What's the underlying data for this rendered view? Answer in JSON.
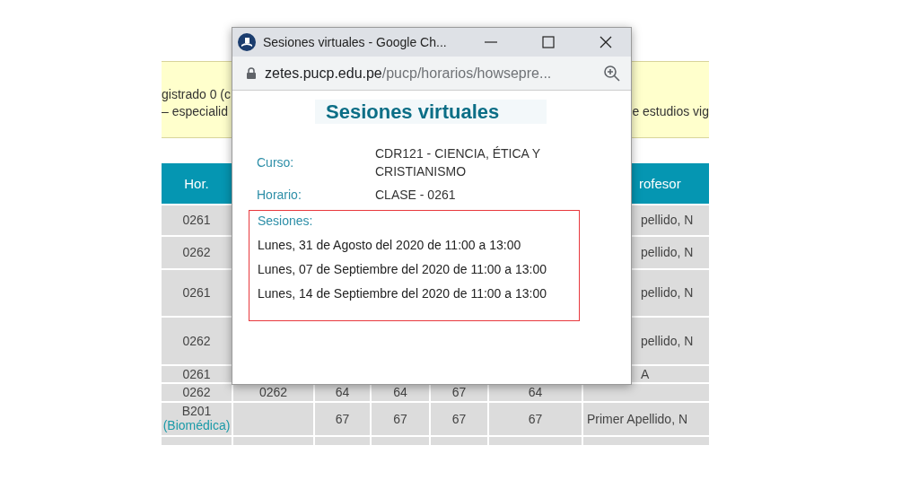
{
  "notice": {
    "left_lines": [
      "gistrado 0 (c",
      "– especialid"
    ],
    "right_text": "e estudios vig"
  },
  "table": {
    "columns": [
      {
        "label": "Hor."
      },
      {},
      {},
      {},
      {},
      {},
      {
        "label": "rofesor"
      }
    ],
    "rows": [
      {
        "cells": [
          "0261",
          null,
          null,
          null,
          null,
          null,
          "pellido, N"
        ]
      },
      {
        "cells": [
          "0262",
          null,
          null,
          null,
          null,
          null,
          "pellido, N"
        ]
      },
      {
        "cells": [
          "0261",
          null,
          null,
          null,
          null,
          null,
          "pellido, N"
        ]
      },
      {
        "cells": [
          "0262",
          null,
          null,
          null,
          null,
          null,
          "pellido, N"
        ]
      },
      {
        "cells": [
          "0261",
          null,
          null,
          null,
          null,
          null,
          "A"
        ]
      },
      {
        "cells": [
          "0262",
          "0262",
          "64",
          "64",
          "67",
          "64",
          null
        ]
      },
      {
        "cells": [
          "B201",
          null,
          "67",
          "67",
          "67",
          "67",
          "Primer Apellido, N"
        ],
        "note": "(Biomédica)"
      },
      {
        "cells": [
          null,
          null,
          null,
          null,
          null,
          null,
          null
        ]
      }
    ]
  },
  "popup": {
    "title": "Sesiones virtuales - Google Ch...",
    "url_host": "zetes.pucp.edu.pe",
    "url_path": "/pucp/horarios/howsepre...",
    "heading": "Sesiones virtuales",
    "fields": [
      {
        "label": "Curso:",
        "value": "CDR121 - CIENCIA, ÉTICA Y CRISTIANISMO"
      },
      {
        "label": "Horario:",
        "value": "CLASE - 0261"
      }
    ],
    "sessions_label": "Sesiones:",
    "sessions": [
      "Lunes, 31 de Agosto del 2020 de 11:00 a 13:00",
      "Lunes, 07 de Septiembre del 2020 de 11:00 a 13:00",
      "Lunes, 14 de Septiembre del 2020 de 11:00 a 13:00"
    ]
  }
}
